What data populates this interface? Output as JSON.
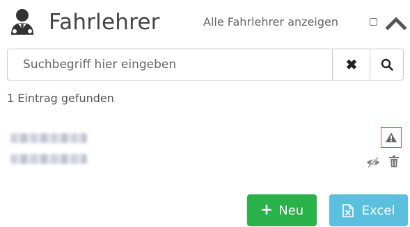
{
  "header": {
    "title": "Fahrlehrer",
    "show_all_label": "Alle Fahrlehrer anzeigen",
    "show_all_checked": false,
    "icon": "person-tie-icon",
    "collapse_icon": "chevron-up-icon"
  },
  "search": {
    "placeholder": "Suchbegriff hier eingeben",
    "value": "",
    "clear_symbol": "✖",
    "clear_icon": "close-icon",
    "search_icon": "search-icon"
  },
  "results": {
    "count_text": "1 Eintrag gefunden",
    "entries": [
      {
        "name": "",
        "subtitle": "",
        "warning_icon": "warning-icon",
        "hide_icon": "eye-slash-icon",
        "delete_icon": "trash-icon"
      }
    ]
  },
  "actions": {
    "new_label": "Neu",
    "new_symbol": "+",
    "excel_label": "Excel",
    "new_color": "#29b24a",
    "excel_color": "#5bc0de"
  },
  "colors": {
    "warning_border": "#e05555"
  }
}
